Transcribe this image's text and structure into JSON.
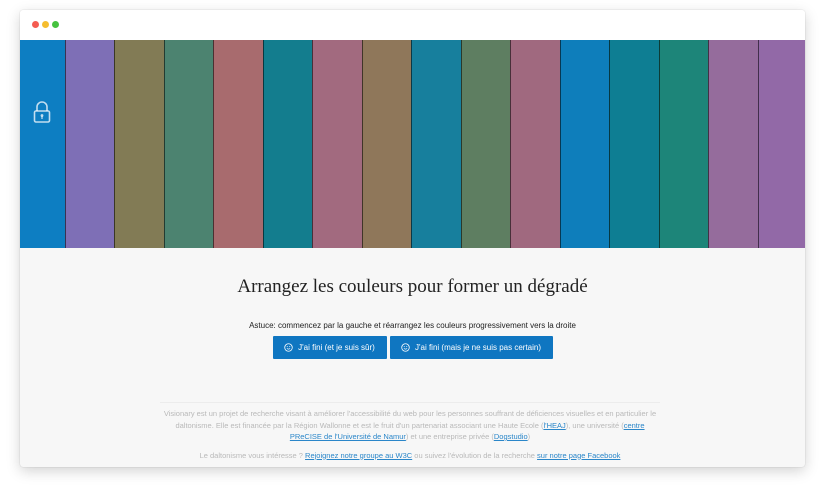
{
  "window_controls": [
    "close",
    "minimize",
    "maximize"
  ],
  "stripes": [
    {
      "color": "#0d7ec2"
    },
    {
      "color": "#7e6fb6"
    },
    {
      "color": "#827b55"
    },
    {
      "color": "#4c8370"
    },
    {
      "color": "#a86b6e"
    },
    {
      "color": "#137d8e"
    },
    {
      "color": "#a26a7f"
    },
    {
      "color": "#8f775a"
    },
    {
      "color": "#177f9d"
    },
    {
      "color": "#5e7e61"
    },
    {
      "color": "#a0697f"
    },
    {
      "color": "#0e7ebb"
    },
    {
      "color": "#0e7e93"
    },
    {
      "color": "#1d8579"
    },
    {
      "color": "#956c9c"
    },
    {
      "color": "#9269a7"
    }
  ],
  "lock_icon": "padlock-icon",
  "heading": "Arrangez les couleurs pour former un dégradé",
  "hint": "Astuce: commencez par la gauche et réarrangez les couleurs progressivement vers la droite",
  "buttons": {
    "sure": {
      "label": "J'ai fini (et je suis sûr)",
      "icon": "smiley-icon"
    },
    "unsure": {
      "label": "J'ai fini (mais je ne suis pas certain)",
      "icon": "smiley-icon"
    },
    "color": "#0f76c1"
  },
  "footer": {
    "p1_a": "Visionary est un projet de recherche visant à améliorer l'accessibilité du web pour les personnes souffrant de déficiences visuelles et en particulier le daltonisme. Elle est financée par la Région Wallonne et est le fruit d'un partenariat associant une Haute Ecole (",
    "link_heaj": "l'HEAJ",
    "p1_b": "), une université (",
    "link_precise": "centre PReCISE de l'Université de Namur",
    "p1_c": ") et une entreprise privée (",
    "link_dogstudio": "Dogstudio",
    "p1_d": ")",
    "p2_a": "Le daltonisme vous intéresse ? ",
    "link_w3c": "Rejoignez notre groupe au W3C",
    "p2_b": " ou suivez l'évolution de la recherche ",
    "link_facebook": "sur notre page Facebook"
  }
}
